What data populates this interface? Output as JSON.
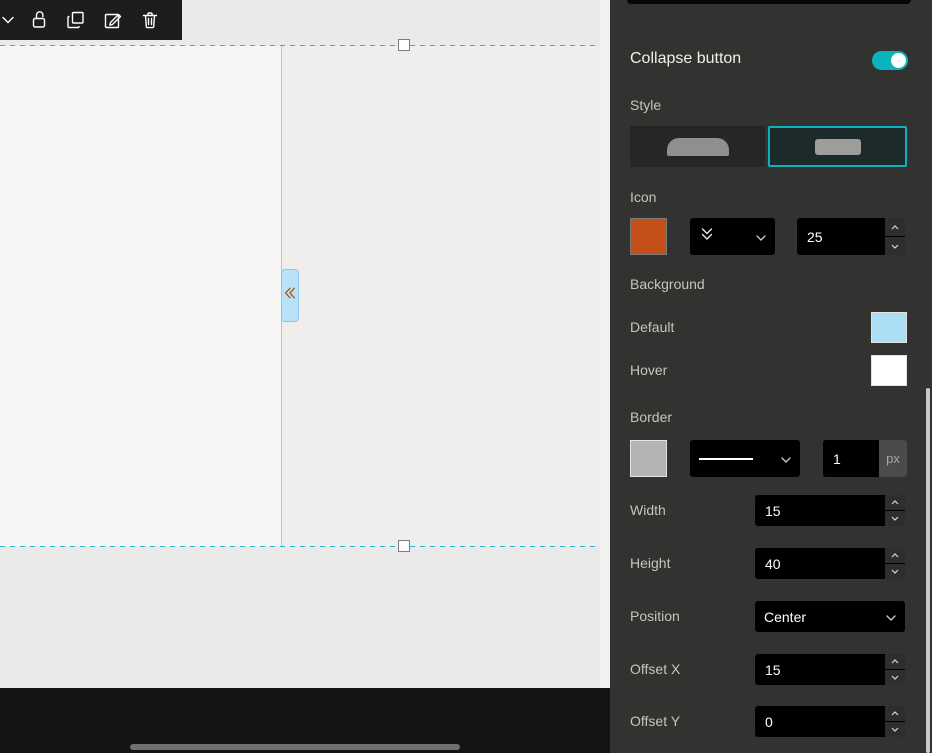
{
  "accent": "#0bb3bd",
  "canvas": {
    "toolbar_icons": [
      "chevron-down",
      "unlock",
      "duplicate",
      "edit",
      "delete"
    ]
  },
  "panel": {
    "collapse_button_title": "Collapse button",
    "style_label": "Style",
    "icon_label": "Icon",
    "icon_color": "#C25018",
    "icon_size": "25",
    "background_label": "Background",
    "background_default_label": "Default",
    "background_default_color": "#ABDDF4",
    "background_hover_label": "Hover",
    "background_hover_color": "#FFFFFF",
    "border_label": "Border",
    "border_color": "#B4B4B3",
    "border_width_value": "1",
    "border_width_unit": "px",
    "width_label": "Width",
    "width_value": "15",
    "height_label": "Height",
    "height_value": "40",
    "position_label": "Position",
    "position_value": "Center",
    "offset_x_label": "Offset X",
    "offset_x_value": "15",
    "offset_y_label": "Offset Y",
    "offset_y_value": "0"
  }
}
